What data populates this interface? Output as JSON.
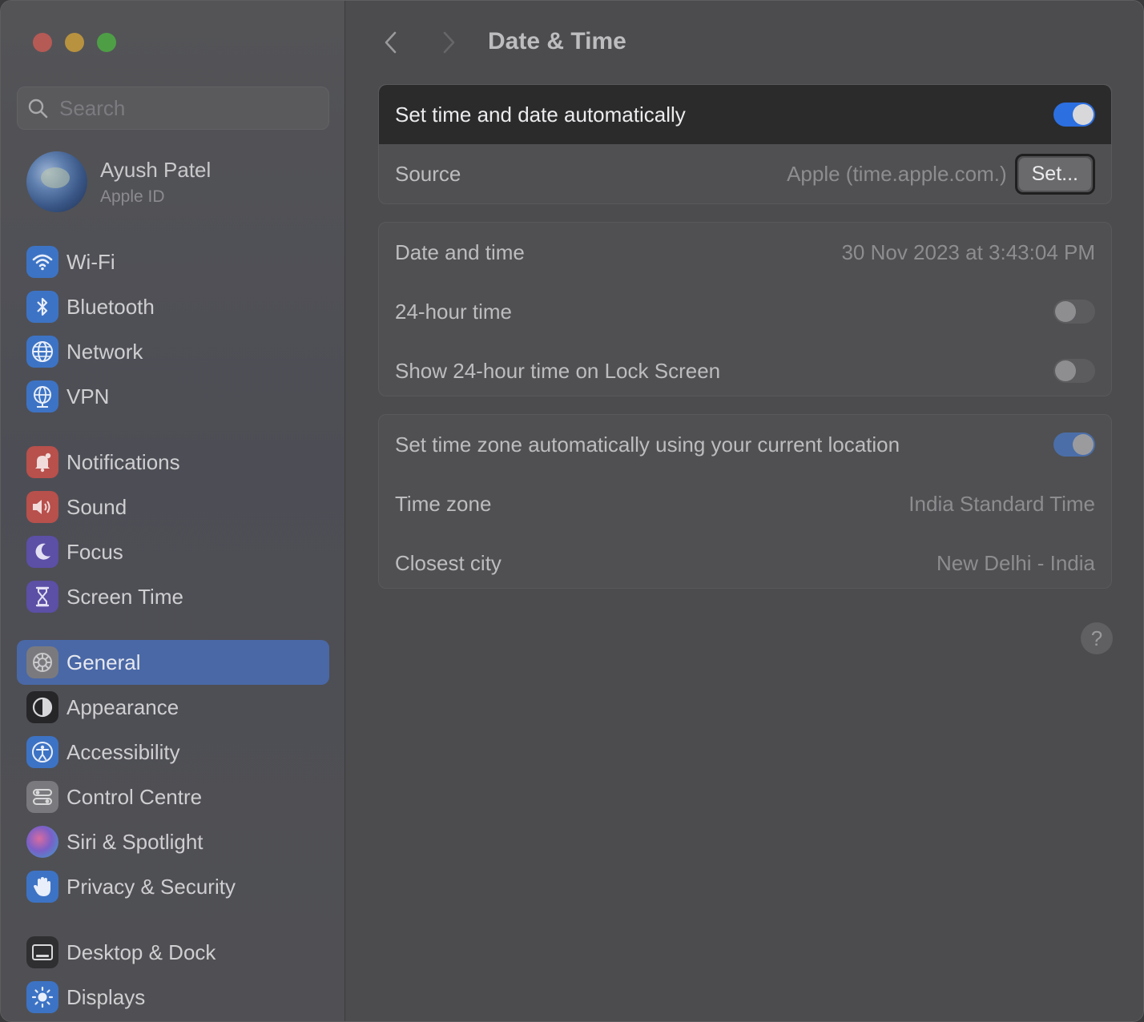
{
  "window": {
    "title": "Date & Time"
  },
  "sidebar": {
    "search_placeholder": "Search",
    "profile": {
      "name": "Ayush Patel",
      "subtitle": "Apple ID"
    },
    "items": [
      {
        "label": "Wi-Fi",
        "icon": "wifi-icon",
        "color": "#3d73c4"
      },
      {
        "label": "Bluetooth",
        "icon": "bluetooth-icon",
        "color": "#3d73c4"
      },
      {
        "label": "Network",
        "icon": "globe-icon",
        "color": "#3d73c4"
      },
      {
        "label": "VPN",
        "icon": "vpn-globe-icon",
        "color": "#3d73c4"
      },
      {
        "label": "Notifications",
        "icon": "bell-icon",
        "color": "#b8504c"
      },
      {
        "label": "Sound",
        "icon": "speaker-icon",
        "color": "#b8504c"
      },
      {
        "label": "Focus",
        "icon": "moon-icon",
        "color": "#5b4fa6"
      },
      {
        "label": "Screen Time",
        "icon": "hourglass-icon",
        "color": "#5b4fa6"
      },
      {
        "label": "General",
        "icon": "gear-icon",
        "color": "#7a7a7e",
        "selected": true
      },
      {
        "label": "Appearance",
        "icon": "appearance-icon",
        "color": "#262628"
      },
      {
        "label": "Accessibility",
        "icon": "accessibility-icon",
        "color": "#3d73c4"
      },
      {
        "label": "Control Centre",
        "icon": "control-centre-icon",
        "color": "#7a7a7e"
      },
      {
        "label": "Siri & Spotlight",
        "icon": "siri-icon",
        "color": "#6a4a8a"
      },
      {
        "label": "Privacy & Security",
        "icon": "hand-icon",
        "color": "#3d73c4"
      },
      {
        "label": "Desktop & Dock",
        "icon": "dock-icon",
        "color": "#2f2f31"
      },
      {
        "label": "Displays",
        "icon": "sun-icon",
        "color": "#3d73c4"
      }
    ]
  },
  "main": {
    "title": "Date & Time",
    "auto_time": {
      "label": "Set time and date automatically",
      "on": true
    },
    "source": {
      "label": "Source",
      "value": "Apple (time.apple.com.)",
      "button": "Set..."
    },
    "date_time": {
      "label": "Date and time",
      "value": "30 Nov 2023 at 3:43:04 PM"
    },
    "hour24": {
      "label": "24-hour time",
      "on": false
    },
    "lock_hour24": {
      "label": "Show 24-hour time on Lock Screen",
      "on": false
    },
    "auto_tz": {
      "label": "Set time zone automatically using your current location",
      "on": true
    },
    "time_zone": {
      "label": "Time zone",
      "value": "India Standard Time"
    },
    "closest_city": {
      "label": "Closest city",
      "value": "New Delhi - India"
    },
    "help": "?"
  },
  "colors": {
    "accent": "#2c6fe0",
    "selected_sidebar": "#4a68a6"
  }
}
